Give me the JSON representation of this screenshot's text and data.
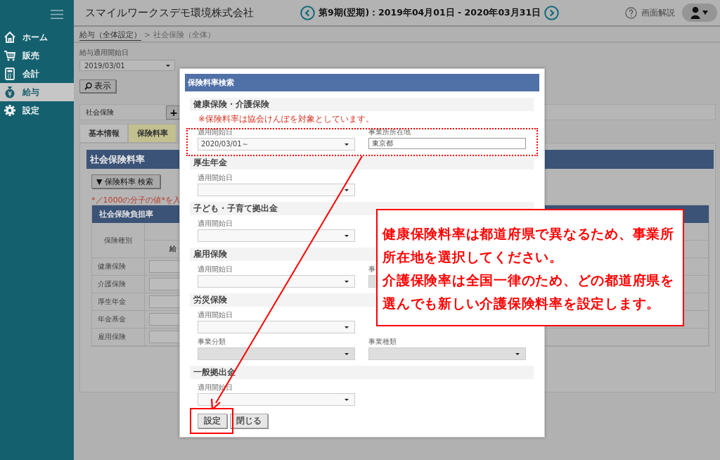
{
  "sidebar": {
    "items": [
      {
        "label": "ホーム",
        "selected": false
      },
      {
        "label": "販売",
        "selected": false
      },
      {
        "label": "会計",
        "selected": false
      },
      {
        "label": "給与",
        "selected": true
      },
      {
        "label": "設定",
        "selected": false
      }
    ]
  },
  "header": {
    "company": "スマイルワークスデモ環境株式会社",
    "period": "第9期(翌期)：2019年04月01日 - 2020年03月31日",
    "help": "画面解説"
  },
  "breadcrumb": {
    "link": "給与（全体設定）",
    "separator": ">",
    "current": "社会保険（全体）"
  },
  "filter": {
    "label": "給与適用開始日",
    "value": "2019/03/01",
    "button": "表示"
  },
  "section_bar": {
    "label": "社会保険",
    "button": "+"
  },
  "tabs": [
    {
      "label": "基本情報",
      "selected": false
    },
    {
      "label": "保険料率",
      "selected": true
    }
  ],
  "panel": {
    "title": "社会保険料率",
    "search_button": "▼ 保険料率 検索",
    "note": "*／1000の分子の値*を入",
    "table": {
      "title": "社会保険負担率",
      "columns": [
        "保険種別",
        "給"
      ],
      "rows": [
        "健康保険",
        "介護保険",
        "厚生年金",
        "年金基金",
        "雇用保険"
      ]
    }
  },
  "modal": {
    "title": "保険料率検索",
    "sections": [
      {
        "title": "健康保険・介護保険",
        "note": "※保険料率は協会けんぽを対象としています。",
        "rows": [
          [
            {
              "label": "適用開始日",
              "kind": "select",
              "value": "2020/03/01～",
              "disabled": false
            },
            {
              "label": "事業所所在地",
              "kind": "text",
              "value": "東京都",
              "disabled": false
            }
          ]
        ]
      },
      {
        "title": "厚生年金",
        "rows": [
          [
            {
              "label": "適用開始日",
              "kind": "select",
              "disabled": false
            }
          ]
        ]
      },
      {
        "title": "子ども・子育て拠出金",
        "rows": [
          [
            {
              "label": "適用開始日",
              "kind": "select",
              "disabled": false
            }
          ]
        ]
      },
      {
        "title": "雇用保険",
        "rows": [
          [
            {
              "label": "適用開始日",
              "kind": "select",
              "disabled": false
            },
            {
              "label": "事",
              "kind": "select",
              "disabled": true
            }
          ]
        ]
      },
      {
        "title": "労災保険",
        "rows": [
          [
            {
              "label": "適用開始日",
              "kind": "select",
              "disabled": false
            }
          ],
          [
            {
              "label": "事業分類",
              "kind": "select",
              "disabled": true
            },
            {
              "label": "事業種類",
              "kind": "select",
              "disabled": true
            }
          ]
        ]
      },
      {
        "title": "一般拠出金",
        "rows": [
          [
            {
              "label": "適用開始日",
              "kind": "select",
              "disabled": false
            }
          ]
        ]
      }
    ],
    "buttons": [
      "設定",
      "閉じる"
    ]
  },
  "callout": {
    "paragraphs": [
      "健康保険料率は都道府県で異なるため、事業所所在地を選択してください。",
      "介護保険率は全国一律のため、どの都道府県を選んでも新しい介護保険料率を設定します。"
    ]
  }
}
